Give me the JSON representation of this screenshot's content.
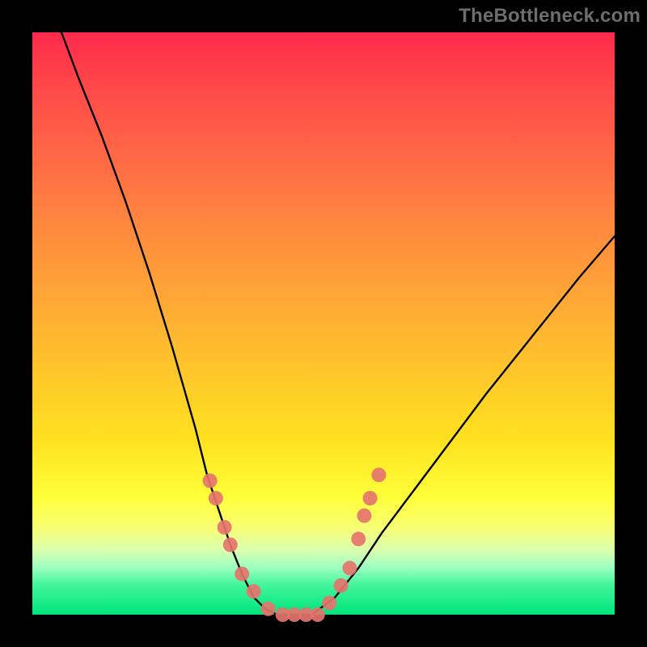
{
  "watermark": "TheBottleneck.com",
  "chart_data": {
    "type": "line",
    "title": "",
    "xlabel": "",
    "ylabel": "",
    "xlim": [
      0,
      100
    ],
    "ylim": [
      0,
      100
    ],
    "grid": false,
    "legend": false,
    "series": [
      {
        "name": "bottleneck-curve",
        "x": [
          5,
          8,
          12,
          16,
          20,
          24,
          28,
          30,
          32,
          34,
          36,
          38,
          40,
          42,
          44,
          48,
          52,
          56,
          60,
          66,
          72,
          78,
          86,
          94,
          100
        ],
        "y": [
          100,
          92,
          82,
          71,
          59,
          46,
          32,
          24,
          18,
          12,
          7,
          3,
          1,
          0,
          0,
          0,
          3,
          8,
          14,
          22,
          30,
          38,
          48,
          58,
          65
        ]
      }
    ],
    "markers": {
      "name": "highlight-dots",
      "points": [
        {
          "x": 30.5,
          "y": 23
        },
        {
          "x": 31.5,
          "y": 20
        },
        {
          "x": 33.0,
          "y": 15
        },
        {
          "x": 34.0,
          "y": 12
        },
        {
          "x": 36.0,
          "y": 7
        },
        {
          "x": 38.0,
          "y": 4
        },
        {
          "x": 40.5,
          "y": 1
        },
        {
          "x": 43.0,
          "y": 0
        },
        {
          "x": 45.0,
          "y": 0
        },
        {
          "x": 47.0,
          "y": 0
        },
        {
          "x": 49.0,
          "y": 0
        },
        {
          "x": 51.0,
          "y": 2
        },
        {
          "x": 53.0,
          "y": 5
        },
        {
          "x": 54.5,
          "y": 8
        },
        {
          "x": 56.0,
          "y": 13
        },
        {
          "x": 57.0,
          "y": 17
        },
        {
          "x": 58.0,
          "y": 20
        },
        {
          "x": 59.5,
          "y": 24
        }
      ]
    },
    "background_gradient": {
      "top": "#ff2a4b",
      "mid_upper": "#ffa836",
      "mid_lower": "#ffff3a",
      "bottom": "#00e37e"
    }
  }
}
